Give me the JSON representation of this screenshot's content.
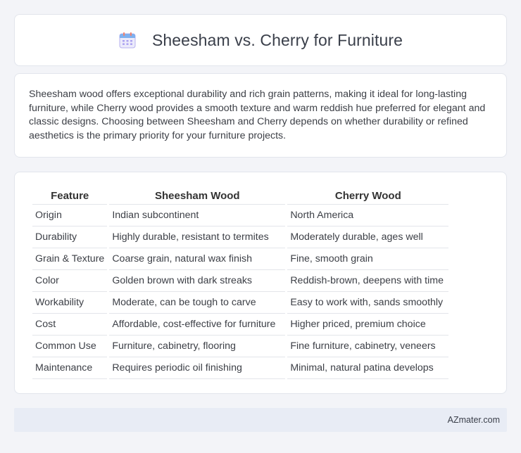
{
  "header": {
    "title": "Sheesham vs. Cherry for Furniture",
    "icon": "calendar-icon"
  },
  "intro": {
    "text": "Sheesham wood offers exceptional durability and rich grain patterns, making it ideal for long-lasting furniture, while Cherry wood provides a smooth texture and warm reddish hue preferred for elegant and classic designs. Choosing between Sheesham and Cherry depends on whether durability or refined aesthetics is the primary priority for your furniture projects."
  },
  "table": {
    "headers": [
      "Feature",
      "Sheesham Wood",
      "Cherry Wood"
    ],
    "rows": [
      [
        "Origin",
        "Indian subcontinent",
        "North America"
      ],
      [
        "Durability",
        "Highly durable, resistant to termites",
        "Moderately durable, ages well"
      ],
      [
        "Grain & Texture",
        "Coarse grain, natural wax finish",
        "Fine, smooth grain"
      ],
      [
        "Color",
        "Golden brown with dark streaks",
        "Reddish-brown, deepens with time"
      ],
      [
        "Workability",
        "Moderate, can be tough to carve",
        "Easy to work with, sands smoothly"
      ],
      [
        "Cost",
        "Affordable, cost-effective for furniture",
        "Higher priced, premium choice"
      ],
      [
        "Common Use",
        "Furniture, cabinetry, flooring",
        "Fine furniture, cabinetry, veneers"
      ],
      [
        "Maintenance",
        "Requires periodic oil finishing",
        "Minimal, natural patina develops"
      ]
    ]
  },
  "footer": {
    "text": "AZmater.com"
  },
  "colors": {
    "background": "#f3f4f8",
    "card": "#ffffff",
    "footer": "#e8ecf5",
    "icon_primary": "#8a7fe0",
    "icon_accent": "#f0826e"
  }
}
